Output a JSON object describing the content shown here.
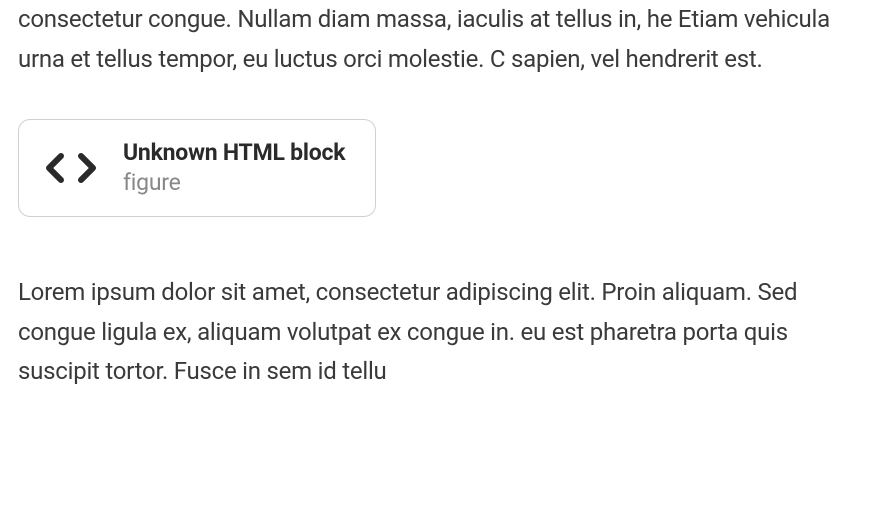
{
  "paragraph_top": "consectetur congue. Nullam diam massa, iaculis at tellus in, he Etiam vehicula urna et tellus tempor, eu luctus orci molestie. C sapien, vel hendrerit est.",
  "html_block": {
    "title": "Unknown HTML block",
    "subtitle": "figure"
  },
  "paragraph_bottom": "Lorem ipsum dolor sit amet, consectetur adipiscing elit. Proin aliquam. Sed congue ligula ex, aliquam volutpat ex congue in. eu est pharetra porta quis suscipit tortor. Fusce in sem id tellu"
}
